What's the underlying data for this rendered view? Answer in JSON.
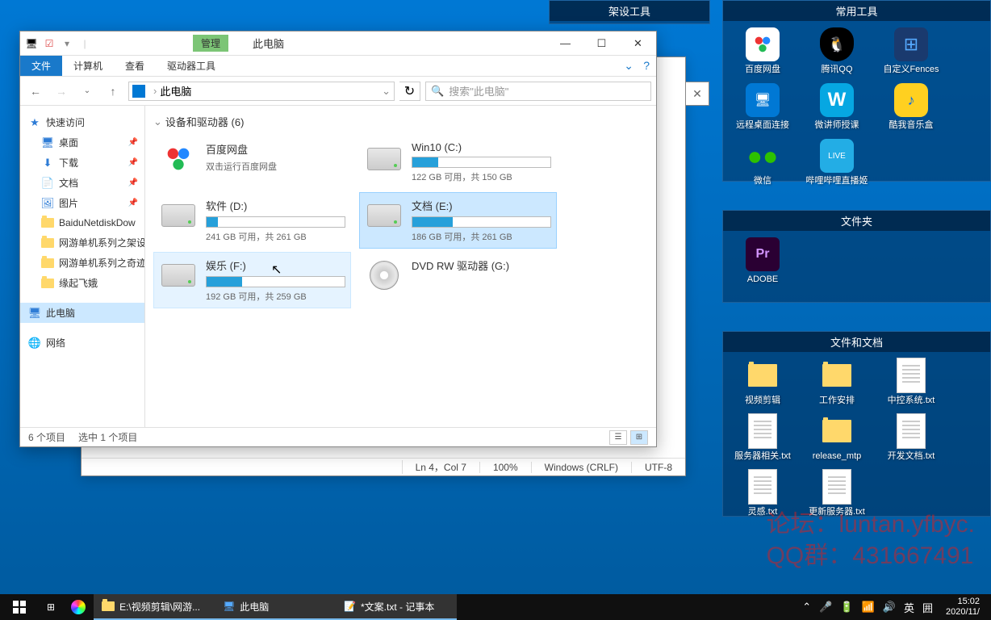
{
  "fences": {
    "tools_setup": {
      "title": "架设工具"
    },
    "tools_common": {
      "title": "常用工具",
      "items": [
        "百度网盘",
        "腾讯QQ",
        "自定义Fences",
        "远程桌面连接",
        "微讲师授课",
        "酷我音乐盒",
        "微信",
        "哔哩哔哩直播姬"
      ]
    },
    "folders": {
      "title": "文件夹",
      "items": [
        "ADOBE"
      ]
    },
    "docs": {
      "title": "文件和文档",
      "items": [
        "视频剪辑",
        "工作安排",
        "中控系统.txt",
        "服务器相关.txt",
        "release_mtp",
        "开发文档.txt",
        "灵感.txt",
        "更新服务器.txt"
      ]
    }
  },
  "explorer": {
    "title": "此电脑",
    "mgmt_tab": "管理",
    "tabs": {
      "file": "文件",
      "computer": "计算机",
      "view": "查看",
      "drive_tools": "驱动器工具"
    },
    "breadcrumb": "此电脑",
    "search_placeholder": "搜索\"此电脑\"",
    "sidebar": {
      "quick": "快速访问",
      "desktop": "桌面",
      "downloads": "下载",
      "documents": "文档",
      "pictures": "图片",
      "baidu": "BaiduNetdiskDow",
      "game1": "网游单机系列之架设",
      "game2": "网游单机系列之奇迹",
      "yuan": "缘起飞娥",
      "thispc": "此电脑",
      "network": "网络"
    },
    "group_header": "设备和驱动器 (6)",
    "drives": [
      {
        "name": "百度网盘",
        "sub": "双击运行百度网盘",
        "type": "app"
      },
      {
        "name": "Win10 (C:)",
        "sub": "122 GB 可用，共 150 GB",
        "fill": 19,
        "type": "hdd"
      },
      {
        "name": "软件 (D:)",
        "sub": "241 GB 可用，共 261 GB",
        "fill": 8,
        "type": "hdd"
      },
      {
        "name": "文档 (E:)",
        "sub": "186 GB 可用，共 261 GB",
        "fill": 29,
        "type": "hdd",
        "selected": true
      },
      {
        "name": "娱乐 (F:)",
        "sub": "192 GB 可用，共 259 GB",
        "fill": 26,
        "type": "hdd",
        "hover": true
      },
      {
        "name": "DVD RW 驱动器 (G:)",
        "sub": "",
        "type": "dvd"
      }
    ],
    "status": {
      "count": "6 个项目",
      "selected": "选中 1 个项目"
    }
  },
  "notepad": {
    "status": {
      "pos": "Ln 4，Col 7",
      "zoom": "100%",
      "eol": "Windows (CRLF)",
      "enc": "UTF-8"
    }
  },
  "watermark": {
    "line1": "论坛：luntan.yfbyc.",
    "line2": "QQ群：431667491"
  },
  "taskbar": {
    "item1": "E:\\视频剪辑\\网游...",
    "item2": "此电脑",
    "item3": "*文案.txt - 记事本",
    "ime1": "英",
    "ime2": "囲",
    "time": "15:02",
    "date": "2020/11/"
  }
}
